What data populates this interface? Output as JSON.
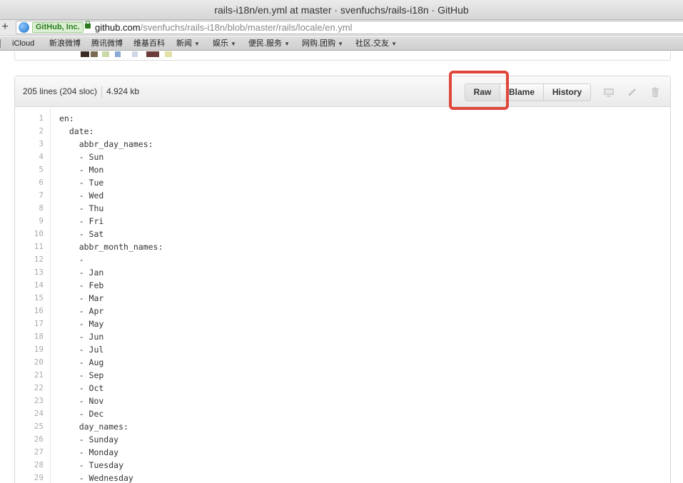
{
  "window": {
    "title": "rails-i18n/en.yml at master · svenfuchs/rails-i18n · GitHub"
  },
  "address_bar": {
    "new_tab_symbol": "+",
    "certificate_label": "GitHub, Inc.",
    "url_host": "github.com",
    "url_path": "/svenfuchs/rails-i18n/blob/master/rails/locale/en.yml"
  },
  "bookmarks": [
    {
      "label": "iCloud",
      "dropdown": false
    },
    {
      "label": "新浪微博",
      "dropdown": false
    },
    {
      "label": "腾讯微博",
      "dropdown": false
    },
    {
      "label": "维基百科",
      "dropdown": false
    },
    {
      "label": "新闻",
      "dropdown": true
    },
    {
      "label": "娱乐",
      "dropdown": true
    },
    {
      "label": "便民.服务",
      "dropdown": true
    },
    {
      "label": "网购.团购",
      "dropdown": true
    },
    {
      "label": "社区.交友",
      "dropdown": true
    }
  ],
  "file": {
    "lines_info": "205 lines (204 sloc)",
    "size": "4.924 kb",
    "buttons": {
      "raw": "Raw",
      "blame": "Blame",
      "history": "History"
    },
    "icons": [
      "desktop-icon",
      "pencil-icon",
      "trash-icon"
    ],
    "code_lines": [
      "en:",
      "  date:",
      "    abbr_day_names:",
      "    - Sun",
      "    - Mon",
      "    - Tue",
      "    - Wed",
      "    - Thu",
      "    - Fri",
      "    - Sat",
      "    abbr_month_names:",
      "    -",
      "    - Jan",
      "    - Feb",
      "    - Mar",
      "    - Apr",
      "    - May",
      "    - Jun",
      "    - Jul",
      "    - Aug",
      "    - Sep",
      "    - Oct",
      "    - Nov",
      "    - Dec",
      "    day_names:",
      "    - Sunday",
      "    - Monday",
      "    - Tuesday",
      "    - Wednesday"
    ]
  },
  "colors": {
    "highlight": "#e0463a",
    "certificate": "#2c7a1e"
  }
}
